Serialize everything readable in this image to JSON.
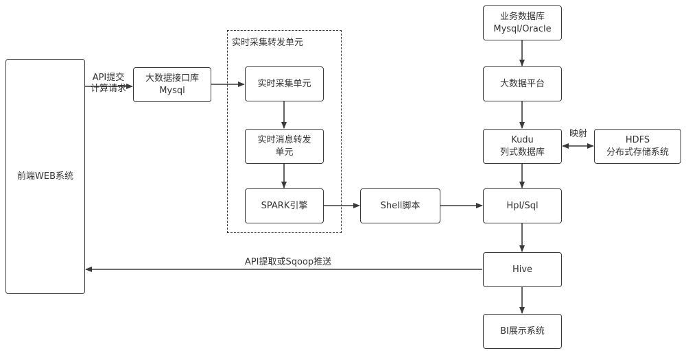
{
  "diagram": {
    "type": "flowchart",
    "colors": {
      "stroke": "#3a3a3a",
      "text": "#333333",
      "background": "#ffffff"
    },
    "groups": [
      {
        "id": "realtime_unit",
        "label": "实时采集转发单元",
        "style": "dashed"
      }
    ],
    "nodes": [
      {
        "id": "web",
        "lines": [
          "前端WEB系统"
        ]
      },
      {
        "id": "bigdata_api_db",
        "lines": [
          "大数据接口库",
          "Mysql"
        ]
      },
      {
        "id": "realtime_collect",
        "lines": [
          "实时采集单元"
        ],
        "group": "realtime_unit"
      },
      {
        "id": "realtime_msg",
        "lines": [
          "实时消息转发",
          "单元"
        ],
        "group": "realtime_unit"
      },
      {
        "id": "spark",
        "lines": [
          "SPARK引擎"
        ],
        "group": "realtime_unit"
      },
      {
        "id": "shell",
        "lines": [
          "Shell脚本"
        ]
      },
      {
        "id": "business_db",
        "lines": [
          "业务数据库",
          "Mysql/Oracle"
        ]
      },
      {
        "id": "bigdata_platform",
        "lines": [
          "大数据平台"
        ]
      },
      {
        "id": "kudu",
        "lines": [
          "Kudu",
          "列式数据库"
        ]
      },
      {
        "id": "hdfs",
        "lines": [
          "HDFS",
          "分布式存储系统"
        ]
      },
      {
        "id": "hplsql",
        "lines": [
          "Hpl/Sql"
        ]
      },
      {
        "id": "hive",
        "lines": [
          "Hive"
        ]
      },
      {
        "id": "bi",
        "lines": [
          "BI展示系统"
        ]
      }
    ],
    "edges": [
      {
        "from": "web",
        "to": "bigdata_api_db",
        "label_lines": [
          "API提交",
          "计算请求"
        ]
      },
      {
        "from": "bigdata_api_db",
        "to": "realtime_collect",
        "label_lines": []
      },
      {
        "from": "realtime_collect",
        "to": "realtime_msg",
        "label_lines": []
      },
      {
        "from": "realtime_msg",
        "to": "spark",
        "label_lines": []
      },
      {
        "from": "spark",
        "to": "shell",
        "label_lines": []
      },
      {
        "from": "shell",
        "to": "hplsql",
        "label_lines": []
      },
      {
        "from": "business_db",
        "to": "bigdata_platform",
        "label_lines": []
      },
      {
        "from": "bigdata_platform",
        "to": "kudu",
        "label_lines": []
      },
      {
        "from": "kudu",
        "to": "hdfs",
        "label_lines": [
          "映射"
        ],
        "bidirectional": true
      },
      {
        "from": "kudu",
        "to": "hplsql",
        "label_lines": []
      },
      {
        "from": "hplsql",
        "to": "hive",
        "label_lines": []
      },
      {
        "from": "hive",
        "to": "bi",
        "label_lines": []
      },
      {
        "from": "hive",
        "to": "web",
        "label_lines": [
          "API提取或Sqoop推送"
        ]
      }
    ]
  }
}
